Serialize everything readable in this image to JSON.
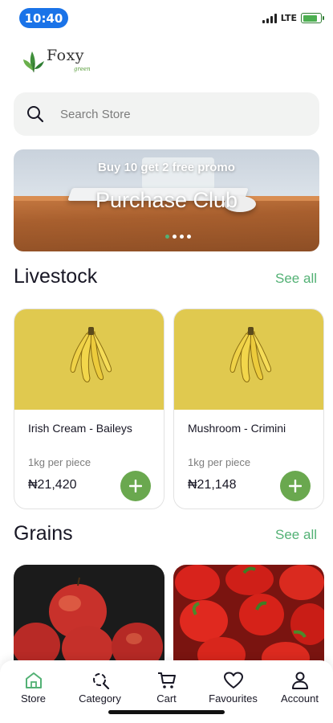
{
  "status": {
    "time": "10:40",
    "network": "LTE",
    "battery_level": 0.85
  },
  "logo": {
    "name": "Foxy",
    "tagline": "green"
  },
  "search": {
    "placeholder": "Search Store"
  },
  "banner": {
    "subtitle": "Buy 10 get 2 free promo",
    "title": "Purchase Club",
    "slides": 4,
    "active_slide": 0
  },
  "sections": {
    "livestock": {
      "title": "Livestock",
      "see_all": "See all"
    },
    "grains": {
      "title": "Grains",
      "see_all": "See all"
    }
  },
  "livestock_products": [
    {
      "name": "Irish Cream - Baileys",
      "unit": "1kg per piece",
      "price": "₦21,420",
      "image": "bananas"
    },
    {
      "name": "Mushroom - Crimini",
      "unit": "1kg per piece",
      "price": "₦21,148",
      "image": "bananas"
    }
  ],
  "grain_products": [
    {
      "image": "apples"
    },
    {
      "image": "red-peppers"
    }
  ],
  "nav": {
    "items": [
      {
        "label": "Store",
        "icon": "home-icon",
        "active": true
      },
      {
        "label": "Category",
        "icon": "category-search-icon",
        "active": false
      },
      {
        "label": "Cart",
        "icon": "cart-icon",
        "active": false
      },
      {
        "label": "Favourites",
        "icon": "heart-icon",
        "active": false
      },
      {
        "label": "Account",
        "icon": "user-icon",
        "active": false
      }
    ]
  },
  "colors": {
    "accent": "#53b175",
    "add_button": "#6aa84f",
    "card_image_bg": "#e0c94f",
    "time_pill": "#1a73e8"
  }
}
